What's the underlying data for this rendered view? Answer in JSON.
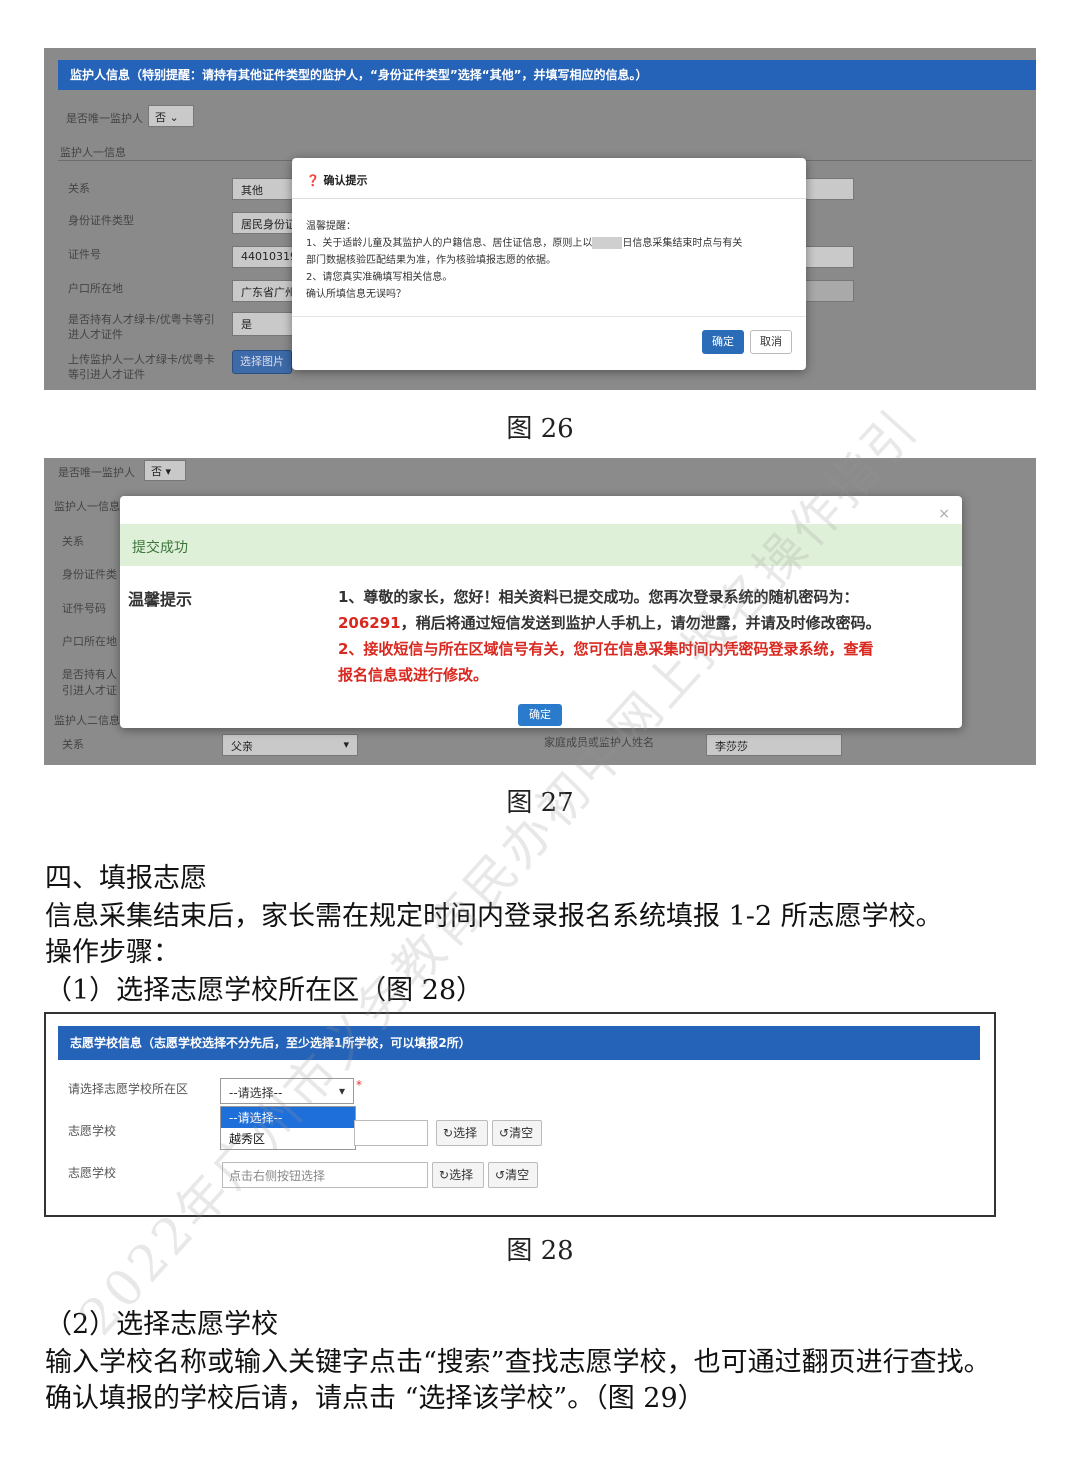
{
  "fig26": {
    "header": "监护人信息（特别提醒：请持有其他证件类型的监护人，“身份证件类型”选择“其他”，并填写相应的信息。）",
    "only_guardian_label": "是否唯一监护人",
    "only_guardian_value": "否",
    "section_title": "监护人一信息",
    "rows": [
      {
        "label": "关系",
        "value": "其他"
      },
      {
        "label": "身份证件类型",
        "value": "居民身份证"
      },
      {
        "label": "证件号",
        "value": "44010319"
      },
      {
        "label": "户口所在地",
        "value": "广东省广州"
      },
      {
        "label": "是否持有人才绿卡/优粤卡等引进人才证件",
        "value": "是"
      }
    ],
    "upload_label": "上传监护人一人才绿卡/优粤卡等引进人才证件",
    "upload_button": "选择图片",
    "dialog": {
      "title": "确认提示",
      "greeting": "温馨提醒：",
      "line1": "1、关于适龄儿童及其监护人的户籍信息、居住证信息，原则上以",
      "line1b": "日信息采集结束时点与有关",
      "line2": "部门数据核验匹配结果为准，作为核验填报志愿的依据。",
      "line3": "2、请您真实准确填写相关信息。",
      "line4": "确认所填信息无误吗？",
      "confirm": "确定",
      "cancel": "取消"
    },
    "caption": "图 26"
  },
  "fig27": {
    "only_guardian_label": "是否唯一监护人",
    "only_guardian_value": "否",
    "section1": "监护人一信息",
    "labels": [
      "关系",
      "身份证件类",
      "证件号码",
      "户口所在地",
      "是否持有人",
      "引进人才证"
    ],
    "section2": "监护人二信息",
    "relation_label": "关系",
    "relation_value": "父亲",
    "family_label": "家庭成员或监护人姓名",
    "family_value": "李莎莎",
    "dialog": {
      "close": "×",
      "title": "提交成功",
      "side_label": "温馨提示",
      "line1": "1、尊敬的家长，您好！相关资料已提交成功。您再次登录系统的随机密码为：",
      "password": "206291",
      "line2": "，稍后将通过短信发送到监护人手机上，请勿泄露，并请及时修改密码。",
      "line3": "2、接收短信与所在区域信号有关，您可在信息采集时间内凭密码登录系统，查看",
      "line4": "报名信息或进行修改。",
      "confirm": "确定"
    },
    "caption": "图 27"
  },
  "section4": {
    "heading": "四、填报志愿",
    "p1": "信息采集结束后，家长需在规定时间内登录报名系统填报 1-2 所志愿学校。",
    "p2": "操作步骤：",
    "p3": "（1）选择志愿学校所在区（图 28）"
  },
  "fig28": {
    "header": "志愿学校信息（志愿学校选择不分先后，至少选择1所学校，可以填报2所）",
    "district_label": "请选择志愿学校所在区",
    "district_value": "--请选择--",
    "options": [
      "--请选择--",
      "越秀区"
    ],
    "school_label_1": "志愿学校",
    "school_label_2": "志愿学校",
    "school_placeholder": "点击右侧按钮选择",
    "select_btn": "选择",
    "clear_btn": "清空",
    "caption": "图 28"
  },
  "after": {
    "p4": "（2）选择志愿学校",
    "p5": "输入学校名称或输入关键字点击“搜索”查找志愿学校，也可通过翻页进行查找。",
    "p6": "确认填报的学校后请，请点击 “选择该学校”。（图 29）"
  },
  "watermark": "2022年广州市义务教育民办初中网上报名操作指引"
}
